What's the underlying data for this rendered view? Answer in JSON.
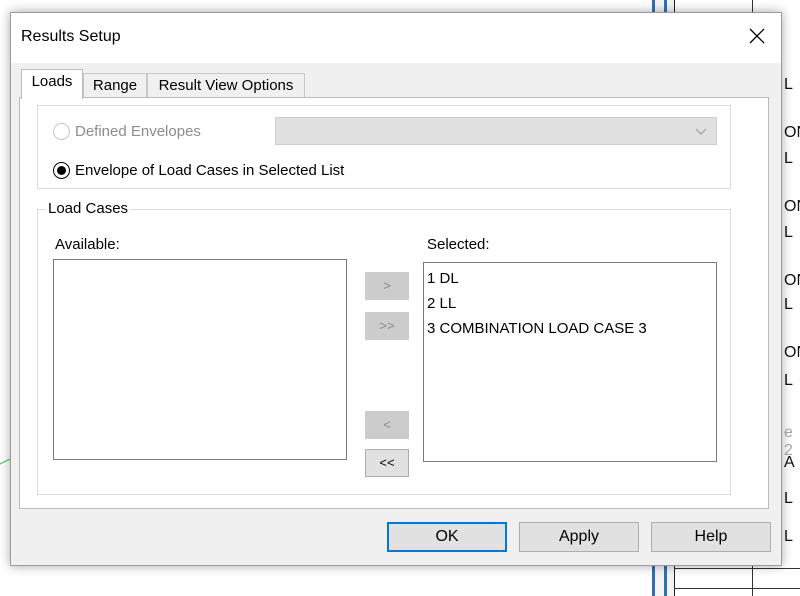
{
  "background_app": {
    "cells": [
      "L",
      "ON",
      "L",
      "ON",
      "L",
      "ON",
      "L",
      "ON",
      "L",
      "e 2",
      "A",
      "L",
      "L"
    ]
  },
  "dialog": {
    "title": "Results Setup",
    "close_icon": "close-icon",
    "tabs": [
      {
        "label": "Loads",
        "active": true
      },
      {
        "label": "Range",
        "active": false
      },
      {
        "label": "Result View Options",
        "active": false
      }
    ],
    "envelope": {
      "defined_label": "Defined Envelopes",
      "defined_selected": false,
      "defined_enabled": false,
      "combo_value": "",
      "selected_list_label": "Envelope of Load Cases in Selected List",
      "selected_list_selected": true
    },
    "load_cases": {
      "group_label": "Load Cases",
      "available_label": "Available:",
      "selected_label": "Selected:",
      "available": [],
      "selected": [
        "1 DL",
        "2 LL",
        "3 COMBINATION LOAD CASE 3"
      ]
    },
    "move_buttons": {
      "add": ">",
      "add_all": ">>",
      "remove": "<",
      "remove_all": "<<"
    },
    "footer": {
      "ok": "OK",
      "apply": "Apply",
      "help": "Help"
    }
  }
}
